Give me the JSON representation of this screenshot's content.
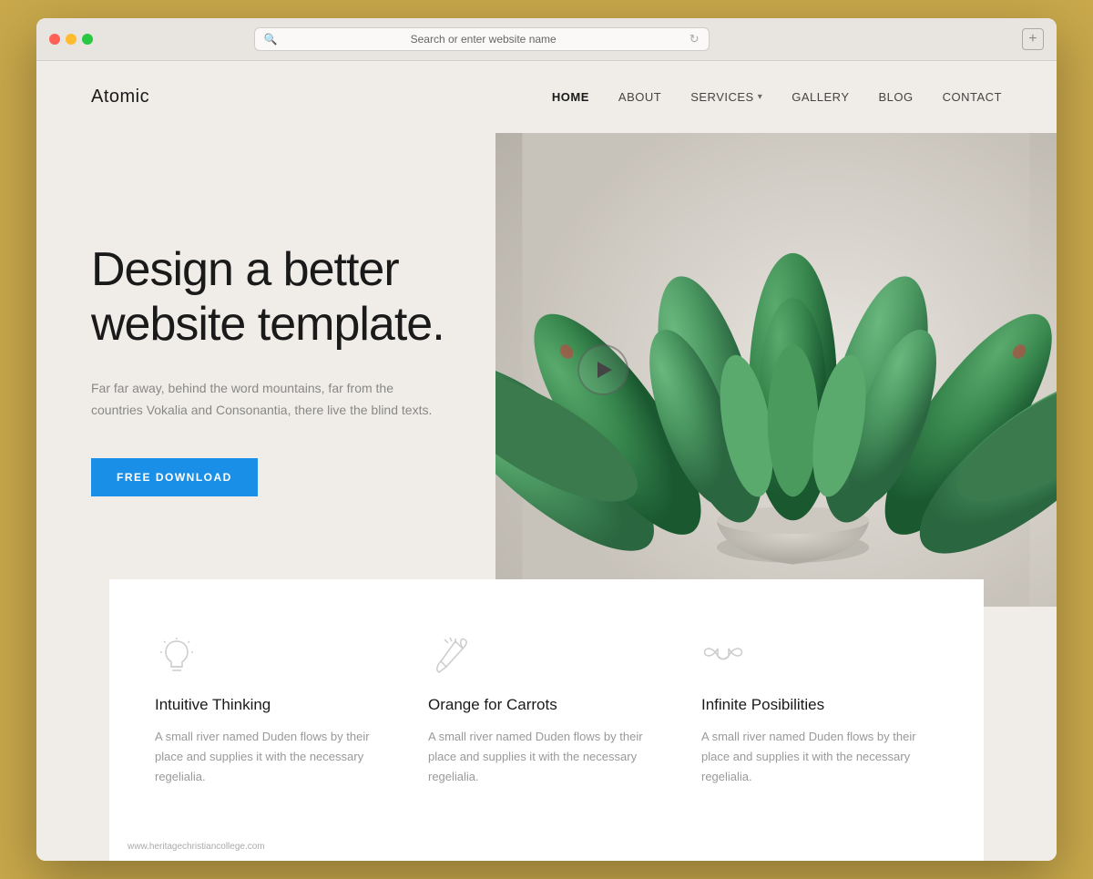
{
  "browser": {
    "address_bar_text": "Search or enter website name",
    "new_tab_icon": "+"
  },
  "site": {
    "logo": "Atomic",
    "nav": {
      "home": "HOME",
      "about": "ABOUT",
      "services": "SERVICES",
      "gallery": "GALLERY",
      "blog": "BLOG",
      "contact": "CONTACT"
    },
    "hero": {
      "title": "Design a better website template.",
      "subtitle": "Far far away, behind the word mountains, far from the countries Vokalia and Consonantia, there live the blind texts.",
      "cta_label": "FREE DOWNLOAD"
    },
    "features": [
      {
        "icon": "lightbulb-icon",
        "title": "Intuitive Thinking",
        "description": "A small river named Duden flows by their place and supplies it with the necessary regelialia."
      },
      {
        "icon": "carrot-icon",
        "title": "Orange for Carrots",
        "description": "A small river named Duden flows by their place and supplies it with the necessary regelialia."
      },
      {
        "icon": "infinity-icon",
        "title": "Infinite Posibilities",
        "description": "A small river named Duden flows by their place and supplies it with the necessary regelialia."
      }
    ],
    "watermark": "www.heritagechristiancollege.com"
  }
}
